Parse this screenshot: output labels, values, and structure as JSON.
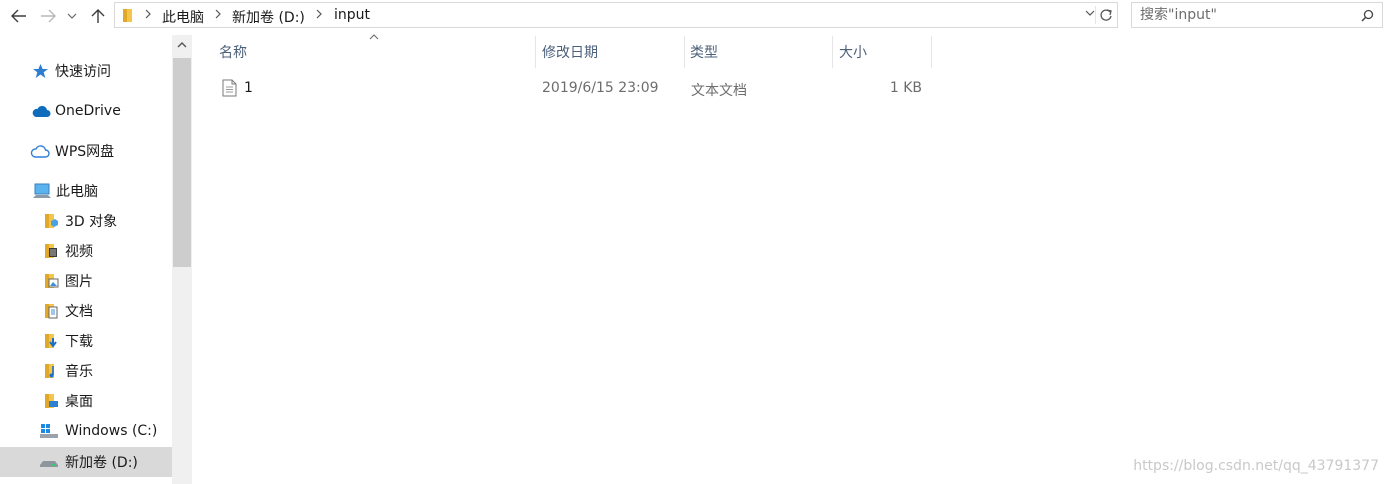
{
  "toolbar": {
    "back_icon": "arrow-left-icon",
    "forward_icon": "arrow-right-icon",
    "recent_icon": "chevron-down-icon",
    "up_icon": "arrow-up-icon"
  },
  "address": {
    "crumbs": [
      "此电脑",
      "新加卷 (D:)",
      "input"
    ]
  },
  "search": {
    "placeholder": "搜索\"input\""
  },
  "sidebar": {
    "items": [
      {
        "label": "快速访问",
        "icon": "star-icon"
      },
      {
        "label": "OneDrive",
        "icon": "onedrive-cloud-icon"
      },
      {
        "label": "WPS网盘",
        "icon": "wps-cloud-icon"
      },
      {
        "label": "此电脑",
        "icon": "computer-icon"
      },
      {
        "label": "3D 对象",
        "icon": "3d-objects-folder-icon"
      },
      {
        "label": "视频",
        "icon": "videos-folder-icon"
      },
      {
        "label": "图片",
        "icon": "pictures-folder-icon"
      },
      {
        "label": "文档",
        "icon": "documents-folder-icon"
      },
      {
        "label": "下载",
        "icon": "downloads-folder-icon"
      },
      {
        "label": "音乐",
        "icon": "music-folder-icon"
      },
      {
        "label": "桌面",
        "icon": "desktop-folder-icon"
      },
      {
        "label": "Windows (C:)",
        "icon": "windows-drive-icon"
      },
      {
        "label": "新加卷 (D:)",
        "icon": "drive-icon",
        "selected": true
      }
    ]
  },
  "columns": {
    "name": "名称",
    "modified": "修改日期",
    "type": "类型",
    "size": "大小"
  },
  "files": [
    {
      "name": "1",
      "modified": "2019/6/15 23:09",
      "type": "文本文档",
      "size": "1 KB",
      "icon": "text-file-icon"
    }
  ],
  "watermark": "https://blog.csdn.net/qq_43791377",
  "colors": {
    "header_text": "#4c607a",
    "selection": "#d9d9d9",
    "folder_yellow": "#f3c64b"
  }
}
